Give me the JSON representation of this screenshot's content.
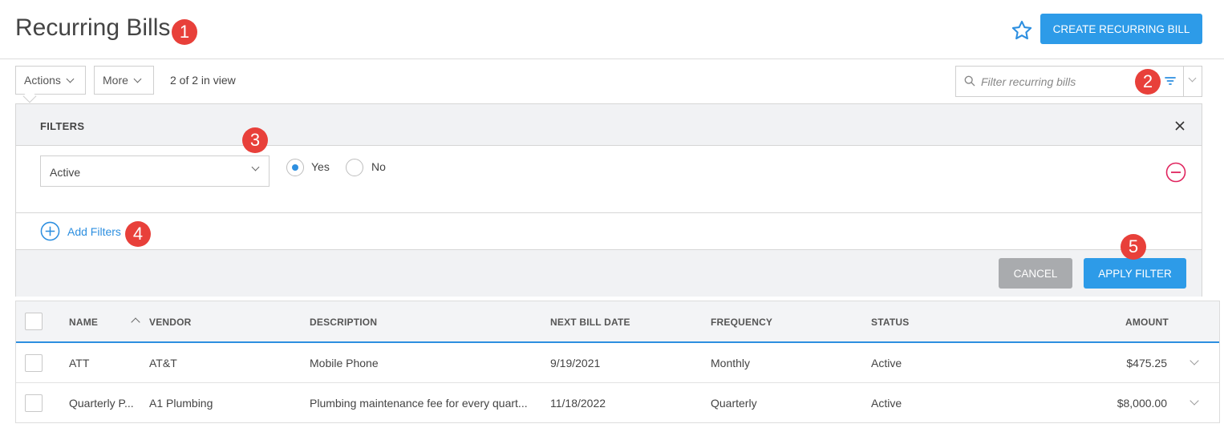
{
  "header": {
    "title": "Recurring Bills",
    "create_button": "CREATE RECURRING BILL"
  },
  "badges": [
    "1",
    "2",
    "3",
    "4",
    "5"
  ],
  "toolbar": {
    "actions_label": "Actions",
    "more_label": "More",
    "in_view": "2 of 2 in view"
  },
  "search": {
    "placeholder": "Filter recurring bills"
  },
  "filters": {
    "title": "FILTERS",
    "field": "Active",
    "options": [
      {
        "label": "Yes",
        "selected": true
      },
      {
        "label": "No",
        "selected": false
      }
    ],
    "add_label": "Add Filters",
    "cancel_label": "CANCEL",
    "apply_label": "APPLY FILTER"
  },
  "table": {
    "columns": [
      "NAME",
      "VENDOR",
      "DESCRIPTION",
      "NEXT BILL DATE",
      "FREQUENCY",
      "STATUS",
      "AMOUNT"
    ],
    "rows": [
      {
        "name": "ATT",
        "vendor": "AT&T",
        "description": "Mobile Phone",
        "next_bill_date": "9/19/2021",
        "frequency": "Monthly",
        "status": "Active",
        "amount": "$475.25"
      },
      {
        "name": "Quarterly P...",
        "vendor": "A1 Plumbing",
        "description": "Plumbing maintenance fee for every quart...",
        "next_bill_date": "11/18/2022",
        "frequency": "Quarterly",
        "status": "Active",
        "amount": "$8,000.00"
      }
    ]
  },
  "colors": {
    "accent": "#2d9be8",
    "badge": "#e8403a",
    "remove": "#e0245e",
    "cancel": "#a9abae"
  }
}
